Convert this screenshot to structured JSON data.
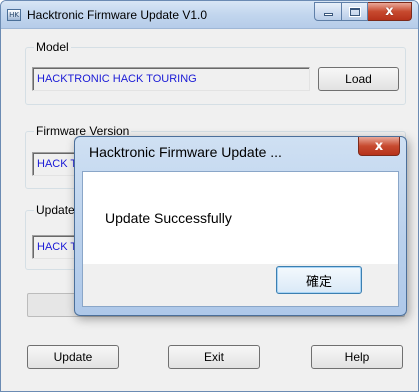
{
  "window": {
    "title": "Hacktronic Firmware Update V1.0",
    "app_icon_text": "HK",
    "close_glyph": "x"
  },
  "model": {
    "label": "Model",
    "value": "HACKTRONIC HACK TOURING",
    "load_label": "Load"
  },
  "firmware": {
    "label": "Firmware Version",
    "value": "HACK TO"
  },
  "update_file": {
    "label": "Update F",
    "value": "HACK TO"
  },
  "buttons": {
    "update": "Update",
    "exit": "Exit",
    "help": "Help"
  },
  "dialog": {
    "title": "Hacktronic Firmware Update ...",
    "message": "Update Successfully",
    "ok_label": "確定",
    "close_glyph": "x"
  },
  "colors": {
    "field_text": "#1a1ad6",
    "title_bar": "#c2d6ee",
    "close_red": "#c74a2f"
  }
}
